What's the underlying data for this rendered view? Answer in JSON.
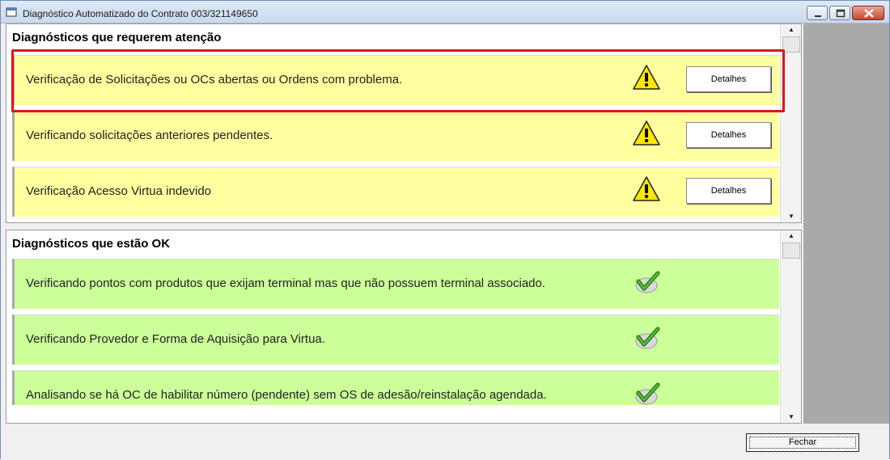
{
  "window": {
    "title": "Diagnóstico Automatizado do Contrato 003/321149650",
    "controls": [
      "minimize-icon",
      "maximize-icon",
      "close-icon"
    ]
  },
  "attention": {
    "title": "Diagnósticos que requerem atenção",
    "items": [
      {
        "text": "Verificação de Solicitações ou OCs abertas ou Ordens com problema.",
        "icon": "warning-icon",
        "button": "Detalhes",
        "highlighted": true
      },
      {
        "text": "Verificando solicitações anteriores pendentes.",
        "icon": "warning-icon",
        "button": "Detalhes"
      },
      {
        "text": "Verificação Acesso Virtua indevido",
        "icon": "warning-icon",
        "button": "Detalhes"
      }
    ]
  },
  "ok": {
    "title": "Diagnósticos que estão OK",
    "items": [
      {
        "text": "Verificando pontos com produtos que exijam terminal mas que não possuem terminal associado.",
        "icon": "checkmark-icon"
      },
      {
        "text": "Verificando Provedor e Forma de Aquisição para Virtua.",
        "icon": "checkmark-icon"
      },
      {
        "text": "Analisando se há OC de habilitar número (pendente) sem OS de adesão/reinstalação agendada.",
        "icon": "checkmark-icon"
      }
    ]
  },
  "footer": {
    "close_label": "Fechar"
  },
  "colors": {
    "warning_bg": "#ffffa0",
    "ok_bg": "#ccff99",
    "highlight": "#e0141a"
  }
}
